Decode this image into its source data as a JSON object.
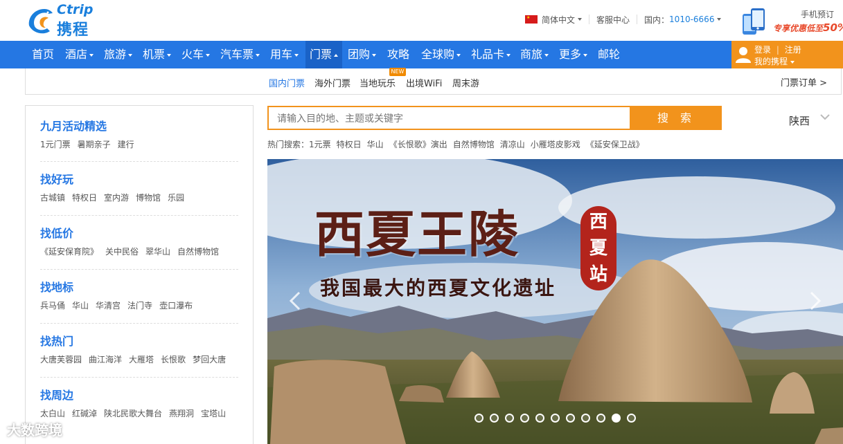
{
  "header": {
    "logo_en": "Ctrip",
    "logo_cn": "携程",
    "language": "简体中文",
    "service": "客服中心",
    "hotline_label": "国内：",
    "hotline_number": "1010-6666",
    "mobile_title": "手机预订",
    "mobile_sub": "专享优惠低至",
    "mobile_pct": "50%"
  },
  "nav": {
    "items": [
      {
        "label": "首页"
      },
      {
        "label": "酒店"
      },
      {
        "label": "旅游"
      },
      {
        "label": "机票"
      },
      {
        "label": "火车"
      },
      {
        "label": "汽车票"
      },
      {
        "label": "用车"
      },
      {
        "label": "门票"
      },
      {
        "label": "团购"
      },
      {
        "label": "攻略"
      },
      {
        "label": "全球购"
      },
      {
        "label": "礼品卡"
      },
      {
        "label": "商旅"
      },
      {
        "label": "更多"
      },
      {
        "label": "邮轮"
      }
    ],
    "login": "登录",
    "register": "注册",
    "my_ctrip": "我的携程"
  },
  "subnav": {
    "items": [
      "国内门票",
      "海外门票",
      "当地玩乐",
      "出境WiFi",
      "周末游"
    ],
    "new_badge": "NEW",
    "orders": "门票订单 >"
  },
  "left_panel": {
    "sections": [
      {
        "title": "九月活动精选",
        "tags": [
          "1元门票",
          "暑期亲子",
          "建行"
        ]
      },
      {
        "title": "找好玩",
        "tags": [
          "古城镇",
          "特权日",
          "室内游",
          "博物馆",
          "乐园"
        ]
      },
      {
        "title": "找低价",
        "tags": [
          "《延安保育院》",
          "关中民俗",
          "翠华山",
          "自然博物馆"
        ]
      },
      {
        "title": "找地标",
        "tags": [
          "兵马俑",
          "华山",
          "华清宫",
          "法门寺",
          "壶口瀑布"
        ]
      },
      {
        "title": "找热门",
        "tags": [
          "大唐芙蓉园",
          "曲江海洋",
          "大雁塔",
          "长恨歌",
          "梦回大唐"
        ]
      },
      {
        "title": "找周边",
        "tags": [
          "太白山",
          "红碱淖",
          "陕北民歌大舞台",
          "燕翔洞",
          "宝塔山"
        ]
      }
    ]
  },
  "search": {
    "placeholder": "请输入目的地、主题或关键字",
    "button": "搜 索",
    "region": "陕西",
    "hot_label": "热门搜索：",
    "hot_items": [
      "1元票",
      "特权日",
      "华山",
      "《长恨歌》演出",
      "自然博物馆",
      "清凉山",
      "小雁塔皮影戏",
      "《延安保卫战》"
    ]
  },
  "banner": {
    "title": "西夏王陵",
    "subtitle": "我国最大的西夏文化遗址",
    "seal": [
      "西",
      "夏",
      "站"
    ],
    "dot_count": 11,
    "active_dot": 9
  },
  "watermark": "大数跨境",
  "colors": {
    "brand_blue": "#2577e3",
    "accent_orange": "#f2931c",
    "link_blue": "#2577e3"
  }
}
